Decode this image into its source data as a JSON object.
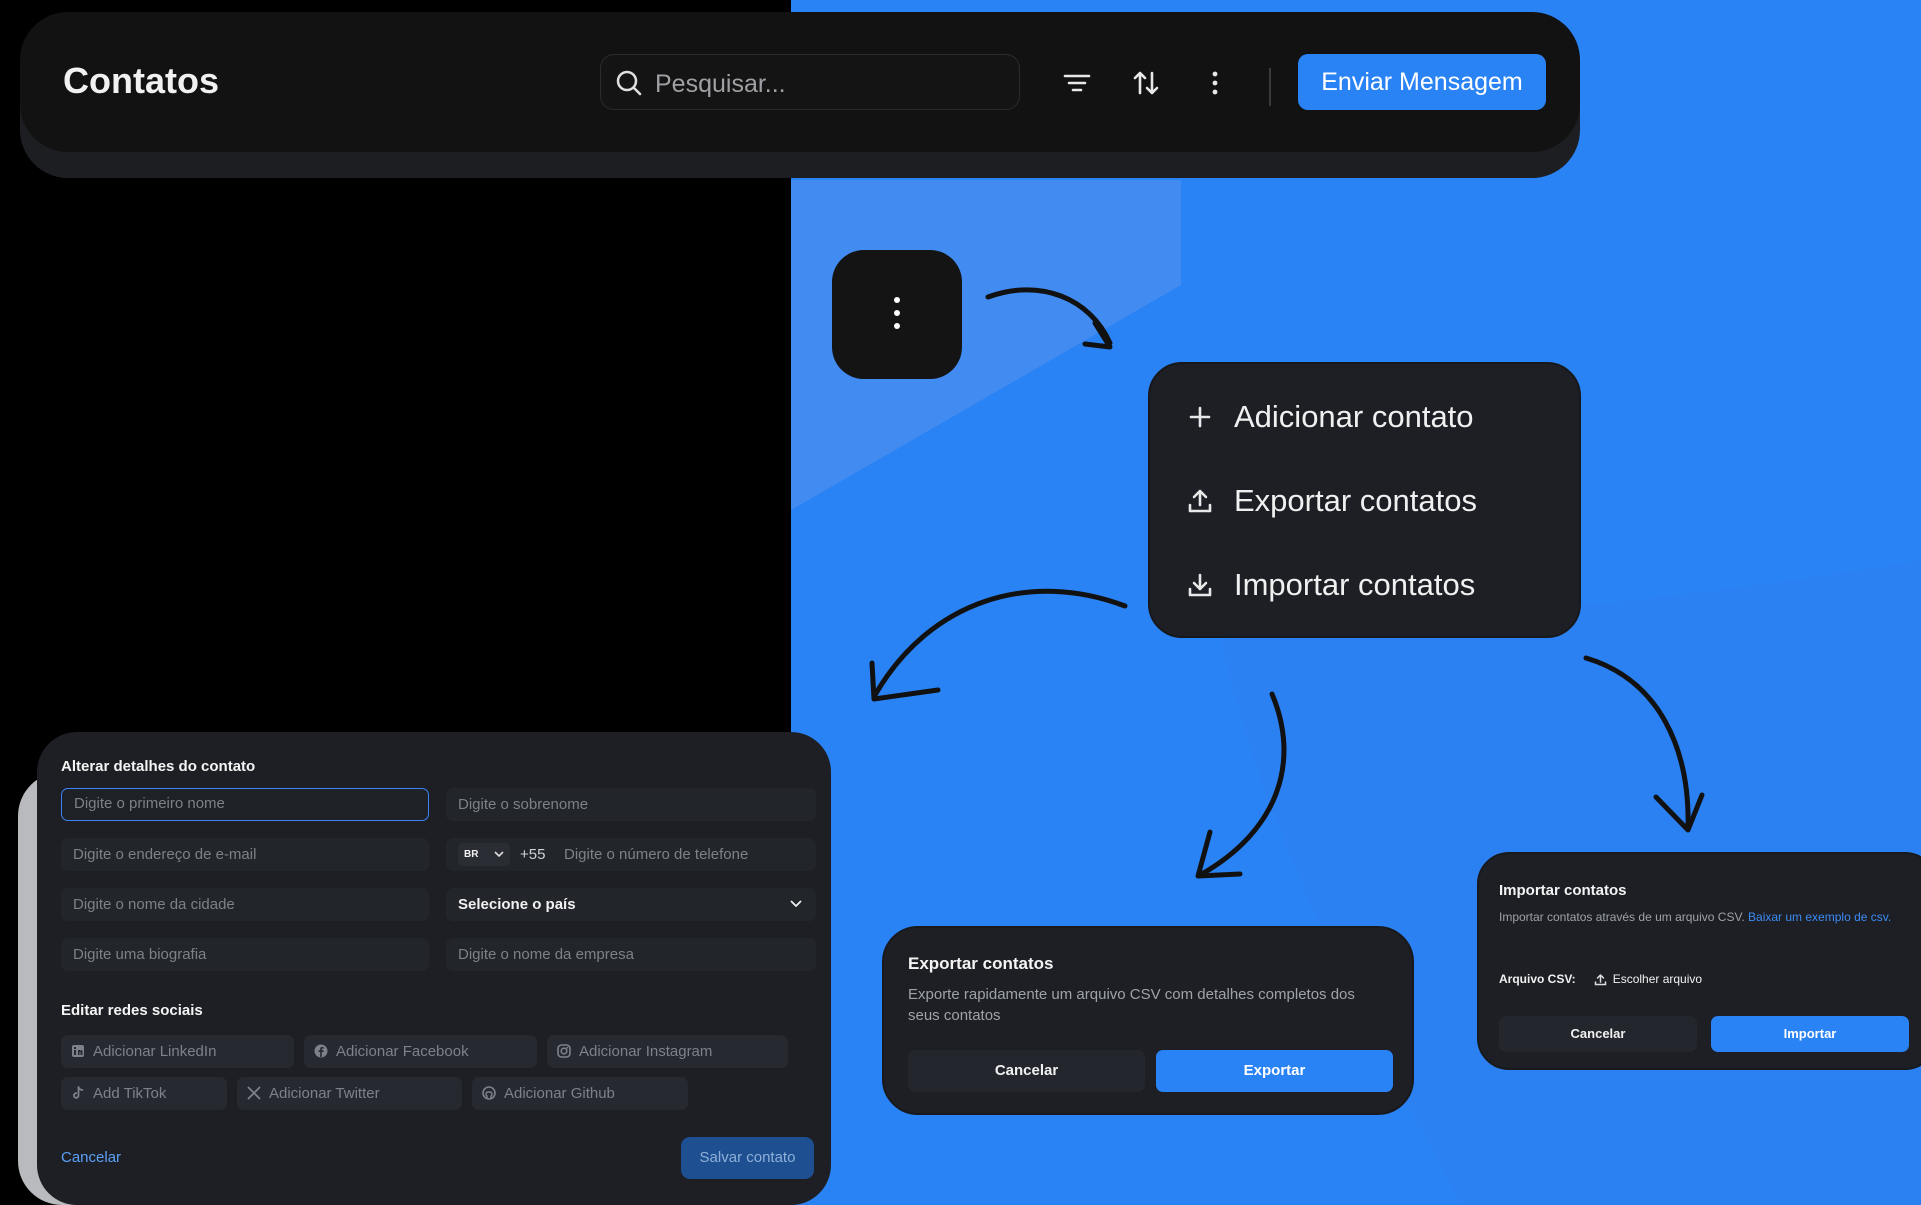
{
  "header": {
    "title": "Contatos",
    "search_placeholder": "Pesquisar...",
    "send_label": "Enviar Mensagem"
  },
  "menu": {
    "items": [
      {
        "label": "Adicionar contato",
        "icon": "plus-icon"
      },
      {
        "label": "Exportar contatos",
        "icon": "upload-icon"
      },
      {
        "label": "Importar contatos",
        "icon": "download-icon"
      }
    ]
  },
  "contact_form": {
    "title": "Alterar detalhes do contato",
    "first_name_placeholder": "Digite o primeiro nome",
    "last_name_placeholder": "Digite o sobrenome",
    "email_placeholder": "Digite o endereço de e-mail",
    "country_code": "BR",
    "dial_code": "+55",
    "phone_placeholder": "Digite o número de telefone",
    "city_placeholder": "Digite o nome da cidade",
    "country_select": "Selecione o país",
    "bio_placeholder": "Digite uma biografia",
    "company_placeholder": "Digite o nome da empresa",
    "social_title": "Editar redes sociais",
    "social": {
      "linkedin": "Adicionar LinkedIn",
      "facebook": "Adicionar Facebook",
      "instagram": "Adicionar Instagram",
      "tiktok": "Add TikTok",
      "twitter": "Adicionar Twitter",
      "github": "Adicionar Github"
    },
    "cancel_label": "Cancelar",
    "save_label": "Salvar contato"
  },
  "export_dialog": {
    "title": "Exportar contatos",
    "description": "Exporte rapidamente um arquivo CSV com detalhes completos dos seus contatos",
    "cancel_label": "Cancelar",
    "confirm_label": "Exportar"
  },
  "import_dialog": {
    "title": "Importar contatos",
    "description": "Importar contatos através de um arquivo CSV.",
    "link": "Baixar um exemplo de csv.",
    "file_label": "Arquivo CSV:",
    "file_button": "Escolher arquivo",
    "cancel_label": "Cancelar",
    "confirm_label": "Importar"
  },
  "colors": {
    "accent": "#2a83f4",
    "panel": "#1d1f24",
    "header": "#121212"
  }
}
